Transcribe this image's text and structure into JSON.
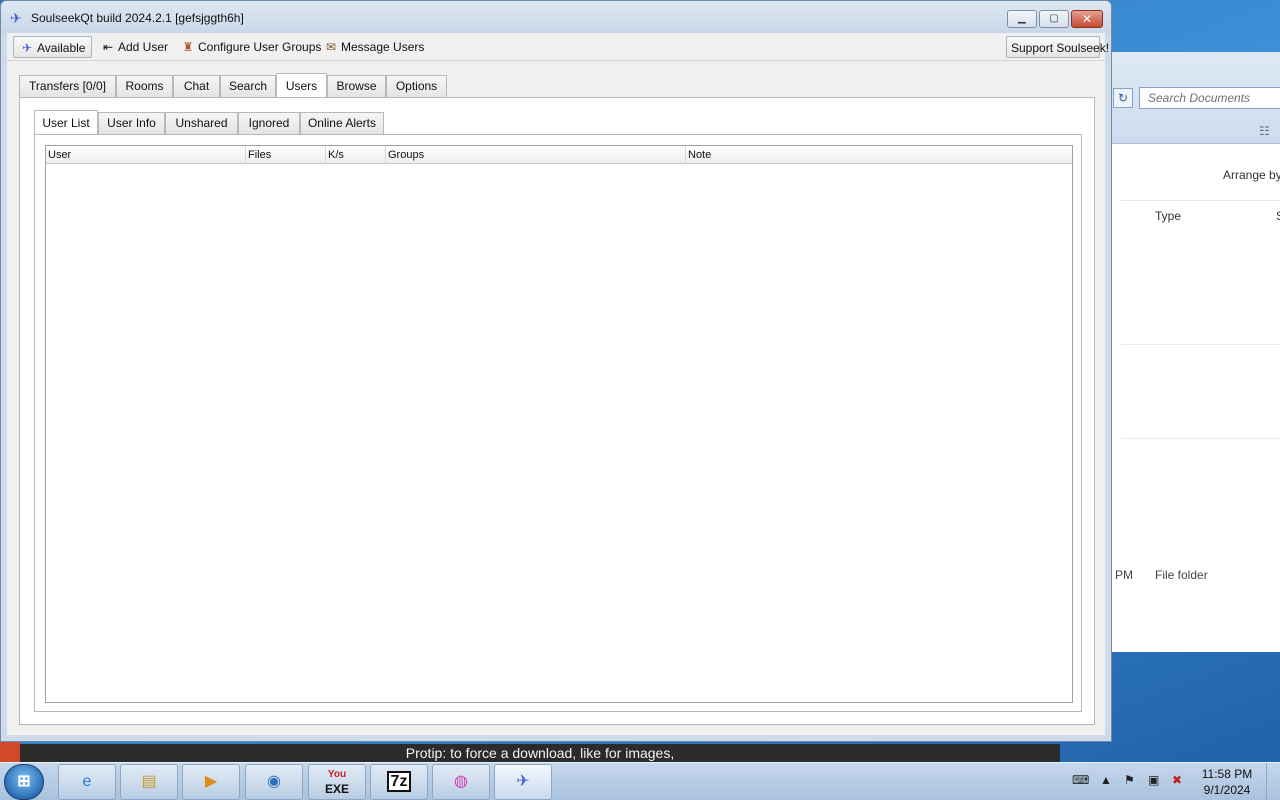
{
  "background_window": {
    "search_placeholder": "Search Documents",
    "arrange_label": "Arrange by",
    "column_type": "Type",
    "column_s": "S",
    "row_time_suffix": "PM",
    "row_type": "File folder",
    "refresh_icon": "↻",
    "view_icon": "☷"
  },
  "caption": {
    "text": "Protip: to force a download, like for images,"
  },
  "window": {
    "title": "SoulseekQt build 2024.2.1 [gefsjggth6h]",
    "app_icon": "✈",
    "min_glyph": "▁",
    "max_glyph": "▢",
    "close_glyph": "✕"
  },
  "toolbar": {
    "available_label": "Available",
    "available_icon": "✈",
    "add_user_label": "Add User",
    "add_user_icon": "⇤",
    "configure_groups_label": "Configure User Groups",
    "configure_groups_icon": "♜",
    "message_users_label": "Message Users",
    "message_users_icon": "✉",
    "support_label": "Support Soulseek!"
  },
  "tabs": [
    {
      "label": "Transfers [0/0]"
    },
    {
      "label": "Rooms"
    },
    {
      "label": "Chat"
    },
    {
      "label": "Search"
    },
    {
      "label": "Users"
    },
    {
      "label": "Browse"
    },
    {
      "label": "Options"
    }
  ],
  "active_tab": "Users",
  "subtabs": [
    {
      "label": "User List"
    },
    {
      "label": "User Info"
    },
    {
      "label": "Unshared"
    },
    {
      "label": "Ignored"
    },
    {
      "label": "Online Alerts"
    }
  ],
  "active_subtab": "User List",
  "user_table": {
    "columns": [
      "User",
      "Files",
      "K/s",
      "Groups",
      "Note"
    ],
    "rows": []
  },
  "taskbar": {
    "start_glyph": "⊞",
    "ie_glyph": "e",
    "folder_glyph": "▤",
    "media_glyph": "▶",
    "browser_glyph": "◉",
    "yt_top": "You",
    "yt_bottom": "EXE",
    "zip_glyph": "7z",
    "pink_glyph": "◍",
    "soulseek_glyph": "✈",
    "clock_time": "11:58 PM",
    "clock_date": "9/1/2024",
    "tray_keyboard": "⌨",
    "tray_up": "▲",
    "tray_flag": "⚑",
    "tray_network": "▣",
    "tray_volume": "✖"
  }
}
